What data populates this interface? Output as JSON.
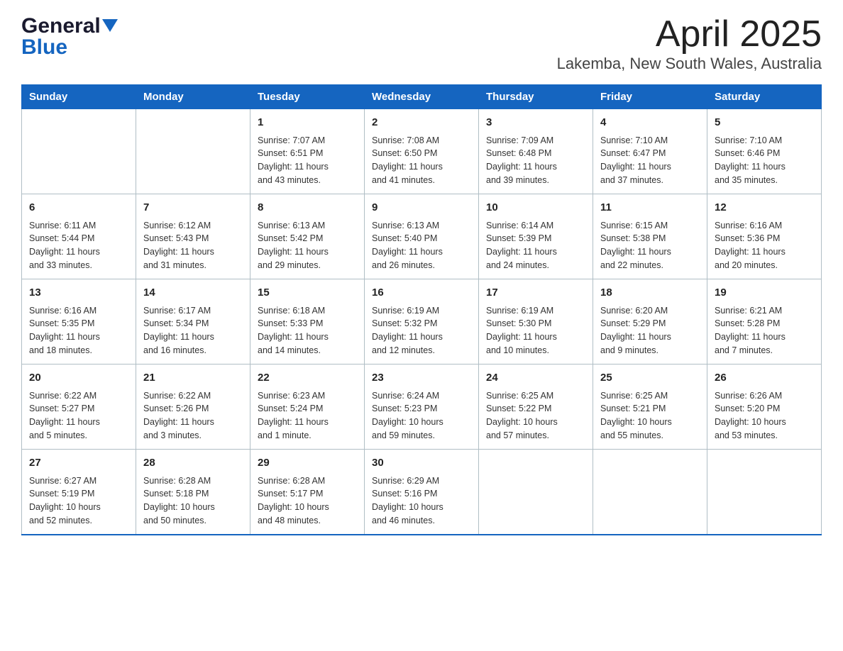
{
  "header": {
    "logo_general": "General",
    "logo_blue": "Blue",
    "title": "April 2025",
    "subtitle": "Lakemba, New South Wales, Australia"
  },
  "days_of_week": [
    "Sunday",
    "Monday",
    "Tuesday",
    "Wednesday",
    "Thursday",
    "Friday",
    "Saturday"
  ],
  "weeks": [
    [
      {
        "day": "",
        "info": ""
      },
      {
        "day": "",
        "info": ""
      },
      {
        "day": "1",
        "info": "Sunrise: 7:07 AM\nSunset: 6:51 PM\nDaylight: 11 hours\nand 43 minutes."
      },
      {
        "day": "2",
        "info": "Sunrise: 7:08 AM\nSunset: 6:50 PM\nDaylight: 11 hours\nand 41 minutes."
      },
      {
        "day": "3",
        "info": "Sunrise: 7:09 AM\nSunset: 6:48 PM\nDaylight: 11 hours\nand 39 minutes."
      },
      {
        "day": "4",
        "info": "Sunrise: 7:10 AM\nSunset: 6:47 PM\nDaylight: 11 hours\nand 37 minutes."
      },
      {
        "day": "5",
        "info": "Sunrise: 7:10 AM\nSunset: 6:46 PM\nDaylight: 11 hours\nand 35 minutes."
      }
    ],
    [
      {
        "day": "6",
        "info": "Sunrise: 6:11 AM\nSunset: 5:44 PM\nDaylight: 11 hours\nand 33 minutes."
      },
      {
        "day": "7",
        "info": "Sunrise: 6:12 AM\nSunset: 5:43 PM\nDaylight: 11 hours\nand 31 minutes."
      },
      {
        "day": "8",
        "info": "Sunrise: 6:13 AM\nSunset: 5:42 PM\nDaylight: 11 hours\nand 29 minutes."
      },
      {
        "day": "9",
        "info": "Sunrise: 6:13 AM\nSunset: 5:40 PM\nDaylight: 11 hours\nand 26 minutes."
      },
      {
        "day": "10",
        "info": "Sunrise: 6:14 AM\nSunset: 5:39 PM\nDaylight: 11 hours\nand 24 minutes."
      },
      {
        "day": "11",
        "info": "Sunrise: 6:15 AM\nSunset: 5:38 PM\nDaylight: 11 hours\nand 22 minutes."
      },
      {
        "day": "12",
        "info": "Sunrise: 6:16 AM\nSunset: 5:36 PM\nDaylight: 11 hours\nand 20 minutes."
      }
    ],
    [
      {
        "day": "13",
        "info": "Sunrise: 6:16 AM\nSunset: 5:35 PM\nDaylight: 11 hours\nand 18 minutes."
      },
      {
        "day": "14",
        "info": "Sunrise: 6:17 AM\nSunset: 5:34 PM\nDaylight: 11 hours\nand 16 minutes."
      },
      {
        "day": "15",
        "info": "Sunrise: 6:18 AM\nSunset: 5:33 PM\nDaylight: 11 hours\nand 14 minutes."
      },
      {
        "day": "16",
        "info": "Sunrise: 6:19 AM\nSunset: 5:32 PM\nDaylight: 11 hours\nand 12 minutes."
      },
      {
        "day": "17",
        "info": "Sunrise: 6:19 AM\nSunset: 5:30 PM\nDaylight: 11 hours\nand 10 minutes."
      },
      {
        "day": "18",
        "info": "Sunrise: 6:20 AM\nSunset: 5:29 PM\nDaylight: 11 hours\nand 9 minutes."
      },
      {
        "day": "19",
        "info": "Sunrise: 6:21 AM\nSunset: 5:28 PM\nDaylight: 11 hours\nand 7 minutes."
      }
    ],
    [
      {
        "day": "20",
        "info": "Sunrise: 6:22 AM\nSunset: 5:27 PM\nDaylight: 11 hours\nand 5 minutes."
      },
      {
        "day": "21",
        "info": "Sunrise: 6:22 AM\nSunset: 5:26 PM\nDaylight: 11 hours\nand 3 minutes."
      },
      {
        "day": "22",
        "info": "Sunrise: 6:23 AM\nSunset: 5:24 PM\nDaylight: 11 hours\nand 1 minute."
      },
      {
        "day": "23",
        "info": "Sunrise: 6:24 AM\nSunset: 5:23 PM\nDaylight: 10 hours\nand 59 minutes."
      },
      {
        "day": "24",
        "info": "Sunrise: 6:25 AM\nSunset: 5:22 PM\nDaylight: 10 hours\nand 57 minutes."
      },
      {
        "day": "25",
        "info": "Sunrise: 6:25 AM\nSunset: 5:21 PM\nDaylight: 10 hours\nand 55 minutes."
      },
      {
        "day": "26",
        "info": "Sunrise: 6:26 AM\nSunset: 5:20 PM\nDaylight: 10 hours\nand 53 minutes."
      }
    ],
    [
      {
        "day": "27",
        "info": "Sunrise: 6:27 AM\nSunset: 5:19 PM\nDaylight: 10 hours\nand 52 minutes."
      },
      {
        "day": "28",
        "info": "Sunrise: 6:28 AM\nSunset: 5:18 PM\nDaylight: 10 hours\nand 50 minutes."
      },
      {
        "day": "29",
        "info": "Sunrise: 6:28 AM\nSunset: 5:17 PM\nDaylight: 10 hours\nand 48 minutes."
      },
      {
        "day": "30",
        "info": "Sunrise: 6:29 AM\nSunset: 5:16 PM\nDaylight: 10 hours\nand 46 minutes."
      },
      {
        "day": "",
        "info": ""
      },
      {
        "day": "",
        "info": ""
      },
      {
        "day": "",
        "info": ""
      }
    ]
  ]
}
